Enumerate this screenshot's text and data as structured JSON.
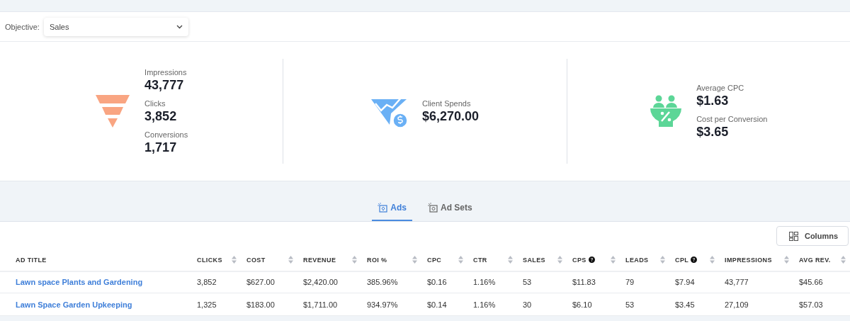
{
  "objective": {
    "label": "Objective:",
    "value": "Sales"
  },
  "stats": [
    {
      "kind": "funnel",
      "metrics": [
        {
          "label": "Impressions",
          "value": "43,777"
        },
        {
          "label": "Clicks",
          "value": "3,852"
        },
        {
          "label": "Conversions",
          "value": "1,717"
        }
      ]
    },
    {
      "kind": "spend",
      "metrics": [
        {
          "label": "Client Spends",
          "value": "$6,270.00"
        }
      ]
    },
    {
      "kind": "bowl",
      "metrics": [
        {
          "label": "Average CPC",
          "value": "$1.63"
        },
        {
          "label": "Cost per Conversion",
          "value": "$3.65"
        }
      ]
    }
  ],
  "tabs": [
    {
      "label": "Ads",
      "selected": true
    },
    {
      "label": "Ad Sets",
      "selected": false
    }
  ],
  "columns_button": "Columns",
  "table": {
    "columns": [
      {
        "label": "AD TITLE",
        "sortable": false,
        "help": false
      },
      {
        "label": "CLICKS",
        "sortable": true,
        "help": false
      },
      {
        "label": "COST",
        "sortable": true,
        "help": false
      },
      {
        "label": "REVENUE",
        "sortable": true,
        "help": false
      },
      {
        "label": "ROI %",
        "sortable": true,
        "help": false
      },
      {
        "label": "CPC",
        "sortable": true,
        "help": false
      },
      {
        "label": "CTR",
        "sortable": true,
        "help": false
      },
      {
        "label": "SALES",
        "sortable": true,
        "help": false
      },
      {
        "label": "CPS",
        "sortable": true,
        "help": true
      },
      {
        "label": "LEADS",
        "sortable": true,
        "help": false
      },
      {
        "label": "CPL",
        "sortable": true,
        "help": true
      },
      {
        "label": "IMPRESSIONS",
        "sortable": true,
        "help": false
      },
      {
        "label": "AVG REV.",
        "sortable": true,
        "help": false
      }
    ],
    "rows": [
      [
        "Lawn space Plants and Gardening",
        "3,852",
        "$627.00",
        "$2,420.00",
        "385.96%",
        "$0.16",
        "1.16%",
        "53",
        "$11.83",
        "79",
        "$7.94",
        "43,777",
        "$45.66"
      ],
      [
        "Lawn Space Garden Upkeeping",
        "1,325",
        "$183.00",
        "$1,711.00",
        "934.97%",
        "$0.14",
        "1.16%",
        "30",
        "$6.10",
        "53",
        "$3.45",
        "27,109",
        "$57.03"
      ]
    ]
  }
}
